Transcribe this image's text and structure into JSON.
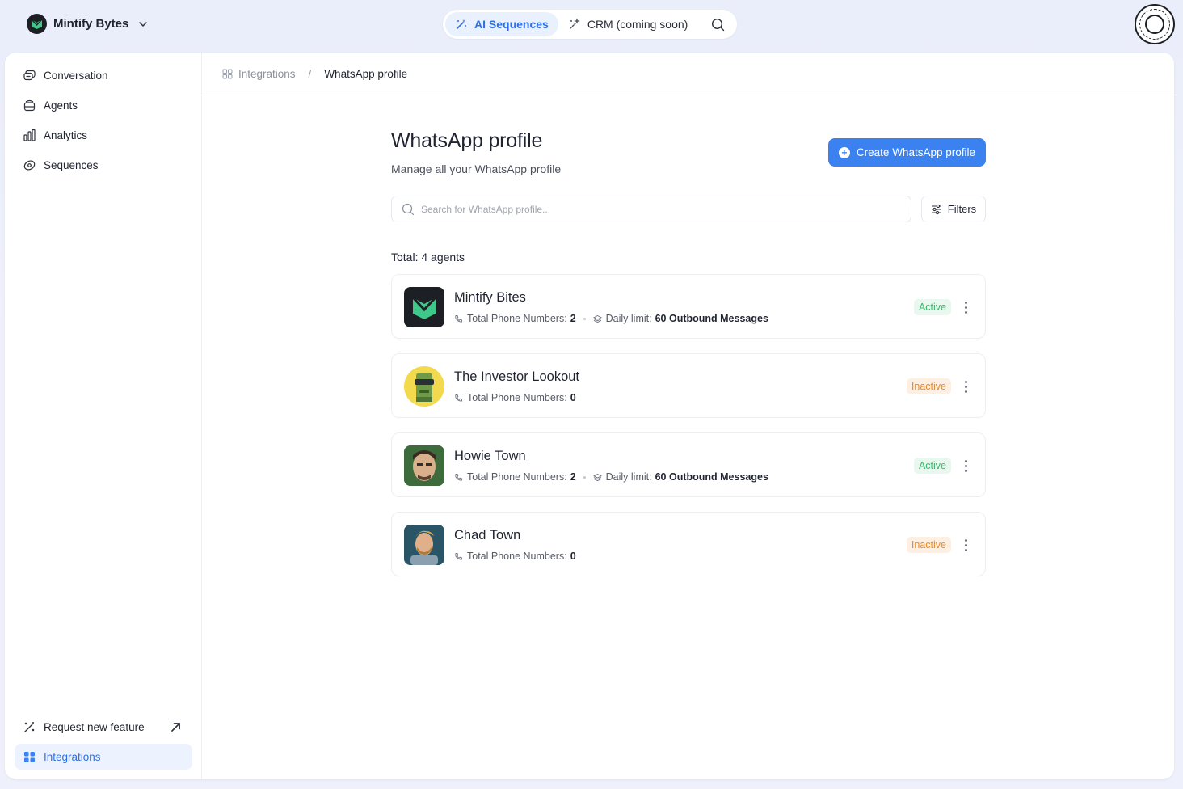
{
  "workspace": {
    "name": "Mintify Bytes"
  },
  "top_nav": {
    "tabs": [
      {
        "label": "AI Sequences",
        "active": true
      },
      {
        "label": "CRM (coming soon)",
        "active": false
      }
    ]
  },
  "sidebar": {
    "items": [
      {
        "label": "Conversation",
        "icon": "chat-icon"
      },
      {
        "label": "Agents",
        "icon": "agent-icon"
      },
      {
        "label": "Analytics",
        "icon": "bar-chart-icon"
      },
      {
        "label": "Sequences",
        "icon": "sequence-icon"
      }
    ],
    "footer": {
      "request_feature": "Request new feature",
      "integrations": "Integrations"
    }
  },
  "breadcrumb": {
    "parent": "Integrations",
    "separator": "/",
    "current": "WhatsApp profile"
  },
  "page": {
    "title": "WhatsApp profile",
    "subtitle": "Manage all your WhatsApp profile",
    "create_label": "Create WhatsApp profile",
    "search_placeholder": "Search for WhatsApp profile...",
    "filters_label": "Filters",
    "total_label": "Total: 4 agents"
  },
  "profiles": [
    {
      "name": "Mintify Bites",
      "phones_label": "Total Phone Numbers:",
      "phones": "2",
      "limit_label": "Daily limit:",
      "limit": "60 Outbound Messages",
      "status": "Active"
    },
    {
      "name": "The Investor Lookout",
      "phones_label": "Total Phone Numbers:",
      "phones": "0",
      "status": "Inactive"
    },
    {
      "name": "Howie Town",
      "phones_label": "Total Phone Numbers:",
      "phones": "2",
      "limit_label": "Daily limit:",
      "limit": "60 Outbound Messages",
      "status": "Active"
    },
    {
      "name": "Chad Town",
      "phones_label": "Total Phone Numbers:",
      "phones": "0",
      "status": "Inactive"
    }
  ],
  "colors": {
    "accent": "#3b82f0",
    "active_text": "#3bb86a",
    "inactive_text": "#e58a2a",
    "brand_green": "#3ec98a"
  }
}
